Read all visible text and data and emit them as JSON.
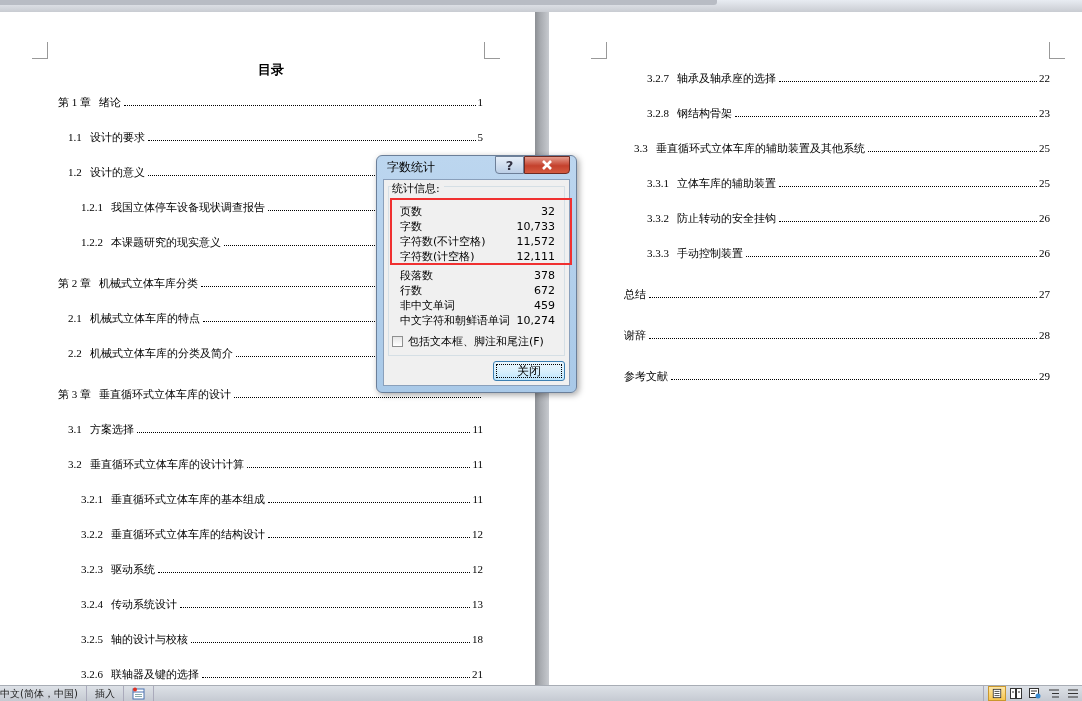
{
  "pages": [
    {
      "heading": "目录",
      "entries": [
        {
          "number": "第 1 章",
          "title": "绪论",
          "page": "1",
          "children": [
            {
              "number": "1.1",
              "title": "设计的要求",
              "page": "5"
            },
            {
              "number": "1.2",
              "title": "设计的意义",
              "children": [
                {
                  "number": "1.2.1",
                  "title": "我国立体停车设备现状调查报告"
                },
                {
                  "number": "1.2.2",
                  "title": "本课题研究的现实意义"
                }
              ]
            }
          ]
        },
        {
          "number": "第 2 章",
          "title": "机械式立体车库分类",
          "children": [
            {
              "number": "2.1",
              "title": "机械式立体车库的特点"
            },
            {
              "number": "2.2",
              "title": "机械式立体车库的分类及简介"
            }
          ]
        },
        {
          "number": "第 3 章",
          "title": "垂直循环式立体车库的设计",
          "children": [
            {
              "number": "3.1",
              "title": "方案选择",
              "page": "11"
            },
            {
              "number": "3.2",
              "title": "垂直循环式立体车库的设计计算",
              "page": "11",
              "children": [
                {
                  "number": "3.2.1",
                  "title": "垂直循环式立体车库的基本组成",
                  "page": "11"
                },
                {
                  "number": "3.2.2",
                  "title": "垂直循环式立体车库的结构设计",
                  "page": "12"
                },
                {
                  "number": "3.2.3",
                  "title": "驱动系统",
                  "page": "12"
                },
                {
                  "number": "3.2.4",
                  "title": "传动系统设计",
                  "page": "13"
                },
                {
                  "number": "3.2.5",
                  "title": "轴的设计与校核",
                  "page": "18"
                },
                {
                  "number": "3.2.6",
                  "title": "联轴器及键的选择",
                  "page": "21"
                }
              ]
            }
          ]
        }
      ]
    },
    {
      "entries": [
        {
          "children": [
            {
              "children": [
                {
                  "number": "3.2.7",
                  "title": "轴承及轴承座的选择",
                  "page": "22"
                },
                {
                  "number": "3.2.8",
                  "title": "钢结构骨架",
                  "page": "23"
                }
              ]
            },
            {
              "number": "3.3",
              "title": "垂直循环式立体车库的辅助装置及其他系统",
              "page": "25",
              "children": [
                {
                  "number": "3.3.1",
                  "title": "立体车库的辅助装置",
                  "page": "25"
                },
                {
                  "number": "3.3.2",
                  "title": "防止转动的安全挂钩",
                  "page": "26"
                },
                {
                  "number": "3.3.3",
                  "title": "手动控制装置",
                  "page": "26"
                }
              ]
            }
          ]
        },
        {
          "title": "总结",
          "page": "27"
        },
        {
          "title": "谢辞",
          "page": "28"
        },
        {
          "title": "参考文献",
          "page": "29"
        }
      ]
    }
  ],
  "dialog": {
    "title": "字数统计",
    "help_button": "?",
    "group_label": "统计信息:",
    "stats": [
      {
        "label": "页数",
        "value": "32"
      },
      {
        "label": "字数",
        "value": "10,733"
      },
      {
        "label": "字符数(不计空格)",
        "value": "11,572"
      },
      {
        "label": "字符数(计空格)",
        "value": "12,111"
      },
      {
        "label": "段落数",
        "value": "378"
      },
      {
        "label": "行数",
        "value": "672"
      },
      {
        "label": "非中文单词",
        "value": "459"
      },
      {
        "label": "中文字符和朝鲜语单词",
        "value": "10,274"
      }
    ],
    "checkbox": {
      "label": "包括文本框、脚注和尾注(F)",
      "checked": false
    },
    "close_button": "关闭"
  },
  "status_bar": {
    "language": "中文(简体，中国)",
    "mode": "插入",
    "views": [
      {
        "kind": "print",
        "selected": true
      },
      {
        "kind": "reading",
        "selected": false
      },
      {
        "kind": "web",
        "selected": false
      },
      {
        "kind": "outline",
        "selected": false
      },
      {
        "kind": "draft",
        "selected": false
      }
    ]
  }
}
